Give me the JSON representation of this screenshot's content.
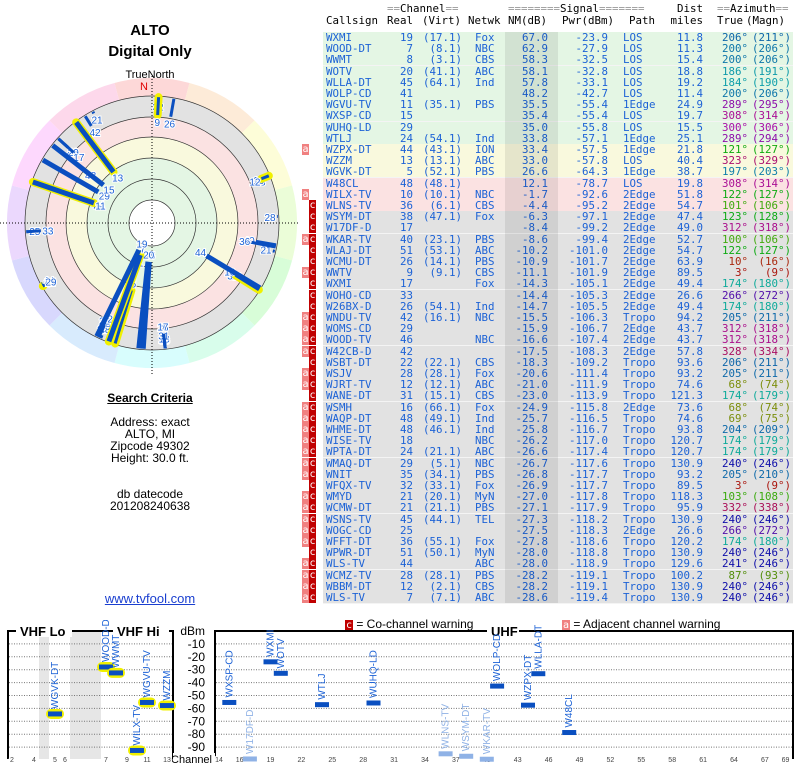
{
  "left": {
    "location": "ALTO",
    "mode": "Digital Only",
    "north_label": "TrueNorth",
    "north_marker": "N",
    "criteria_title": "Search Criteria",
    "criteria": [
      "Address: exact",
      "ALTO, MI",
      "Zipcode 49302",
      "Height: 30.0 ft."
    ],
    "datecode_label": "db datecode",
    "datecode": "201208240638",
    "link": "www.tvfool.com"
  },
  "table": {
    "group_headers": {
      "channel": "Channel",
      "signal": "Signal",
      "dist": "Dist",
      "azimuth": "Azimuth"
    },
    "columns": [
      "Callsign",
      "Real",
      "(Virt)",
      "Netwk",
      "NM(dB)",
      "Pwr(dBm)",
      "Path",
      "miles",
      "True",
      "(Magn)"
    ],
    "zone_colors": {
      "green": "#e4f6e4",
      "yellow": "#f9f9dd",
      "red": "#fbe2e2",
      "gray": "#e2e2e2"
    },
    "rows": [
      {
        "z": "green",
        "f": "",
        "cs": "WXMI",
        "real": 19,
        "virt": "(17.1)",
        "net": "Fox",
        "nm": "67.0",
        "pwr": "-23.9",
        "path": "LOS",
        "dist": "11.8",
        "az": 206,
        "mag": 211
      },
      {
        "z": "green",
        "f": "",
        "cs": "WOOD-DT",
        "real": 7,
        "virt": "(8.1)",
        "net": "NBC",
        "nm": "62.9",
        "pwr": "-27.9",
        "path": "LOS",
        "dist": "11.3",
        "az": 200,
        "mag": 206
      },
      {
        "z": "green",
        "f": "",
        "cs": "WWMT",
        "real": 8,
        "virt": "(3.1)",
        "net": "CBS",
        "nm": "58.3",
        "pwr": "-32.5",
        "path": "LOS",
        "dist": "15.4",
        "az": 200,
        "mag": 206
      },
      {
        "z": "green",
        "f": "",
        "cs": "WOTV",
        "real": 20,
        "virt": "(41.1)",
        "net": "ABC",
        "nm": "58.1",
        "pwr": "-32.8",
        "path": "LOS",
        "dist": "18.8",
        "az": 186,
        "mag": 191
      },
      {
        "z": "green",
        "f": "",
        "cs": "WLLA-DT",
        "real": 45,
        "virt": "(64.1)",
        "net": "Ind",
        "nm": "57.8",
        "pwr": "-33.1",
        "path": "LOS",
        "dist": "19.2",
        "az": 184,
        "mag": 190
      },
      {
        "z": "green",
        "f": "",
        "cs": "WOLP-CD",
        "real": 41,
        "virt": "",
        "net": "",
        "nm": "48.2",
        "pwr": "-42.7",
        "path": "LOS",
        "dist": "11.4",
        "az": 200,
        "mag": 206
      },
      {
        "z": "green",
        "f": "",
        "cs": "WGVU-TV",
        "real": 11,
        "virt": "(35.1)",
        "net": "PBS",
        "nm": "35.5",
        "pwr": "-55.4",
        "path": "1Edge",
        "dist": "24.9",
        "az": 289,
        "mag": 295
      },
      {
        "z": "green",
        "f": "",
        "cs": "WXSP-CD",
        "real": 15,
        "virt": "",
        "net": "",
        "nm": "35.4",
        "pwr": "-55.4",
        "path": "LOS",
        "dist": "19.7",
        "az": 308,
        "mag": 314
      },
      {
        "z": "green",
        "f": "",
        "cs": "WUHQ-LD",
        "real": 29,
        "virt": "",
        "net": "",
        "nm": "35.0",
        "pwr": "-55.8",
        "path": "LOS",
        "dist": "15.5",
        "az": 300,
        "mag": 306
      },
      {
        "z": "green",
        "f": "",
        "cs": "WTLJ",
        "real": 24,
        "virt": "(54.1)",
        "net": "Ind",
        "nm": "33.8",
        "pwr": "-57.1",
        "path": "1Edge",
        "dist": "25.1",
        "az": 289,
        "mag": 294
      },
      {
        "z": "yellow",
        "f": "a",
        "cs": "WZPX-DT",
        "real": 44,
        "virt": "(43.1)",
        "net": "ION",
        "nm": "33.4",
        "pwr": "-57.5",
        "path": "1Edge",
        "dist": "21.8",
        "az": 121,
        "mag": 127
      },
      {
        "z": "yellow",
        "f": "",
        "cs": "WZZM",
        "real": 13,
        "virt": "(13.1)",
        "net": "ABC",
        "nm": "33.0",
        "pwr": "-57.8",
        "path": "LOS",
        "dist": "40.4",
        "az": 323,
        "mag": 329
      },
      {
        "z": "yellow",
        "f": "",
        "cs": "WGVK-DT",
        "real": 5,
        "virt": "(52.1)",
        "net": "PBS",
        "nm": "26.6",
        "pwr": "-64.3",
        "path": "1Edge",
        "dist": "38.7",
        "az": 197,
        "mag": 203
      },
      {
        "z": "red",
        "f": "",
        "cs": "W48CL",
        "real": 48,
        "virt": "(48.1)",
        "net": "",
        "nm": "12.1",
        "pwr": "-78.7",
        "path": "LOS",
        "dist": "19.8",
        "az": 308,
        "mag": 314
      },
      {
        "z": "red",
        "f": "a",
        "cs": "WILX-TV",
        "real": 10,
        "virt": "(10.1)",
        "net": "NBC",
        "nm": "-1.7",
        "pwr": "-92.6",
        "path": "2Edge",
        "dist": "51.8",
        "az": 122,
        "mag": 127
      },
      {
        "z": "red",
        "f": "c",
        "cs": "WLNS-TV",
        "real": 36,
        "virt": "(6.1)",
        "net": "CBS",
        "nm": "-4.4",
        "pwr": "-95.2",
        "path": "2Edge",
        "dist": "54.7",
        "az": 101,
        "mag": 106
      },
      {
        "z": "gray",
        "f": "c",
        "cs": "WSYM-DT",
        "real": 38,
        "virt": "(47.1)",
        "net": "Fox",
        "nm": "-6.3",
        "pwr": "-97.1",
        "path": "2Edge",
        "dist": "47.4",
        "az": 123,
        "mag": 128
      },
      {
        "z": "gray",
        "f": "c",
        "cs": "W17DF-D",
        "real": 17,
        "virt": "",
        "net": "",
        "nm": "-8.4",
        "pwr": "-99.2",
        "path": "2Edge",
        "dist": "49.0",
        "az": 312,
        "mag": 318
      },
      {
        "z": "gray",
        "f": "ac",
        "cs": "WKAR-TV",
        "real": 40,
        "virt": "(23.1)",
        "net": "PBS",
        "nm": "-8.6",
        "pwr": "-99.4",
        "path": "2Edge",
        "dist": "52.7",
        "az": 100,
        "mag": 106
      },
      {
        "z": "gray",
        "f": "c",
        "cs": "WLAJ-DT",
        "real": 51,
        "virt": "(53.1)",
        "net": "ABC",
        "nm": "-10.2",
        "pwr": "-101.0",
        "path": "2Edge",
        "dist": "54.7",
        "az": 122,
        "mag": 127
      },
      {
        "z": "gray",
        "f": "c",
        "cs": "WCMU-DT",
        "real": 26,
        "virt": "(14.1)",
        "net": "PBS",
        "nm": "-10.9",
        "pwr": "-101.7",
        "path": "2Edge",
        "dist": "63.9",
        "az": 10,
        "mag": 16
      },
      {
        "z": "gray",
        "f": "ac",
        "cs": "WWTV",
        "real": 9,
        "virt": "(9.1)",
        "net": "CBS",
        "nm": "-11.1",
        "pwr": "-101.9",
        "path": "2Edge",
        "dist": "89.5",
        "az": 3,
        "mag": 9
      },
      {
        "z": "gray",
        "f": "c",
        "cs": "WXMI",
        "real": 17,
        "virt": "",
        "net": "Fox",
        "nm": "-14.3",
        "pwr": "-105.1",
        "path": "2Edge",
        "dist": "49.4",
        "az": 174,
        "mag": 180
      },
      {
        "z": "gray",
        "f": "c",
        "cs": "WOHO-CD",
        "real": 33,
        "virt": "",
        "net": "",
        "nm": "-14.4",
        "pwr": "-105.3",
        "path": "2Edge",
        "dist": "26.6",
        "az": 266,
        "mag": 272
      },
      {
        "z": "gray",
        "f": "c",
        "cs": "W26BX-D",
        "real": 26,
        "virt": "(54.1)",
        "net": "Ind",
        "nm": "-14.7",
        "pwr": "-105.5",
        "path": "2Edge",
        "dist": "49.4",
        "az": 174,
        "mag": 180
      },
      {
        "z": "gray",
        "f": "ac",
        "cs": "WNDU-TV",
        "real": 42,
        "virt": "(16.1)",
        "net": "NBC",
        "nm": "-15.5",
        "pwr": "-106.3",
        "path": "Tropo",
        "dist": "94.2",
        "az": 205,
        "mag": 211
      },
      {
        "z": "gray",
        "f": "ac",
        "cs": "WOMS-CD",
        "real": 29,
        "virt": "",
        "net": "",
        "nm": "-15.9",
        "pwr": "-106.7",
        "path": "2Edge",
        "dist": "43.7",
        "az": 312,
        "mag": 318
      },
      {
        "z": "gray",
        "f": "ac",
        "cs": "WOOD-TV",
        "real": 46,
        "virt": "",
        "net": "NBC",
        "nm": "-16.6",
        "pwr": "-107.4",
        "path": "2Edge",
        "dist": "43.7",
        "az": 312,
        "mag": 318
      },
      {
        "z": "gray",
        "f": "ac",
        "cs": "W42CB-D",
        "real": 42,
        "virt": "",
        "net": "",
        "nm": "-17.5",
        "pwr": "-108.3",
        "path": "2Edge",
        "dist": "57.8",
        "az": 328,
        "mag": 334
      },
      {
        "z": "gray",
        "f": "c",
        "cs": "WSBT-DT",
        "real": 22,
        "virt": "(22.1)",
        "net": "CBS",
        "nm": "-18.3",
        "pwr": "-109.2",
        "path": "Tropo",
        "dist": "93.6",
        "az": 206,
        "mag": 211
      },
      {
        "z": "gray",
        "f": "ac",
        "cs": "WSJV",
        "real": 28,
        "virt": "(28.1)",
        "net": "Fox",
        "nm": "-20.6",
        "pwr": "-111.4",
        "path": "Tropo",
        "dist": "93.2",
        "az": 205,
        "mag": 211
      },
      {
        "z": "gray",
        "f": "ac",
        "cs": "WJRT-TV",
        "real": 12,
        "virt": "(12.1)",
        "net": "ABC",
        "nm": "-21.0",
        "pwr": "-111.9",
        "path": "Tropo",
        "dist": "74.6",
        "az": 68,
        "mag": 74
      },
      {
        "z": "gray",
        "f": "c",
        "cs": "WANE-DT",
        "real": 31,
        "virt": "(15.1)",
        "net": "CBS",
        "nm": "-23.0",
        "pwr": "-113.9",
        "path": "Tropo",
        "dist": "121.3",
        "az": 174,
        "mag": 179
      },
      {
        "z": "gray",
        "f": "ac",
        "cs": "WSMH",
        "real": 16,
        "virt": "(66.1)",
        "net": "Fox",
        "nm": "-24.9",
        "pwr": "-115.8",
        "path": "2Edge",
        "dist": "73.6",
        "az": 68,
        "mag": 74
      },
      {
        "z": "gray",
        "f": "ac",
        "cs": "WAQP-DT",
        "real": 48,
        "virt": "(49.1)",
        "net": "Ind",
        "nm": "-25.7",
        "pwr": "-116.5",
        "path": "Tropo",
        "dist": "74.6",
        "az": 69,
        "mag": 75
      },
      {
        "z": "gray",
        "f": "ac",
        "cs": "WHME-DT",
        "real": 48,
        "virt": "(46.1)",
        "net": "Ind",
        "nm": "-25.8",
        "pwr": "-116.7",
        "path": "Tropo",
        "dist": "93.8",
        "az": 204,
        "mag": 209
      },
      {
        "z": "gray",
        "f": "ac",
        "cs": "WISE-TV",
        "real": 18,
        "virt": "",
        "net": "NBC",
        "nm": "-26.2",
        "pwr": "-117.0",
        "path": "Tropo",
        "dist": "120.7",
        "az": 174,
        "mag": 179
      },
      {
        "z": "gray",
        "f": "ac",
        "cs": "WPTA-DT",
        "real": 24,
        "virt": "(21.1)",
        "net": "ABC",
        "nm": "-26.6",
        "pwr": "-117.4",
        "path": "Tropo",
        "dist": "120.7",
        "az": 174,
        "mag": 179
      },
      {
        "z": "gray",
        "f": "ac",
        "cs": "WMAQ-DT",
        "real": 29,
        "virt": "(5.1)",
        "net": "NBC",
        "nm": "-26.7",
        "pwr": "-117.6",
        "path": "Tropo",
        "dist": "130.9",
        "az": 240,
        "mag": 246
      },
      {
        "z": "gray",
        "f": "ac",
        "cs": "WNIT",
        "real": 35,
        "virt": "(34.1)",
        "net": "PBS",
        "nm": "-26.8",
        "pwr": "-117.7",
        "path": "Tropo",
        "dist": "93.2",
        "az": 205,
        "mag": 210
      },
      {
        "z": "gray",
        "f": "c",
        "cs": "WFQX-TV",
        "real": 32,
        "virt": "(33.1)",
        "net": "Fox",
        "nm": "-26.9",
        "pwr": "-117.7",
        "path": "Tropo",
        "dist": "89.5",
        "az": 3,
        "mag": 9
      },
      {
        "z": "gray",
        "f": "ac",
        "cs": "WMYD",
        "real": 21,
        "virt": "(20.1)",
        "net": "MyN",
        "nm": "-27.0",
        "pwr": "-117.8",
        "path": "Tropo",
        "dist": "118.3",
        "az": 103,
        "mag": 108
      },
      {
        "z": "gray",
        "f": "ac",
        "cs": "WCMW-DT",
        "real": 21,
        "virt": "(21.1)",
        "net": "PBS",
        "nm": "-27.1",
        "pwr": "-117.9",
        "path": "Tropo",
        "dist": "95.9",
        "az": 332,
        "mag": 338
      },
      {
        "z": "gray",
        "f": "ac",
        "cs": "WSNS-TV",
        "real": 45,
        "virt": "(44.1)",
        "net": "TEL",
        "nm": "-27.3",
        "pwr": "-118.2",
        "path": "Tropo",
        "dist": "130.9",
        "az": 240,
        "mag": 246
      },
      {
        "z": "gray",
        "f": "ac",
        "cs": "WOGC-CD",
        "real": 25,
        "virt": "",
        "net": "",
        "nm": "-27.5",
        "pwr": "-118.3",
        "path": "2Edge",
        "dist": "26.6",
        "az": 266,
        "mag": 272
      },
      {
        "z": "gray",
        "f": "ac",
        "cs": "WFFT-DT",
        "real": 36,
        "virt": "(55.1)",
        "net": "Fox",
        "nm": "-27.8",
        "pwr": "-118.6",
        "path": "Tropo",
        "dist": "120.2",
        "az": 174,
        "mag": 180
      },
      {
        "z": "gray",
        "f": "c",
        "cs": "WPWR-DT",
        "real": 51,
        "virt": "(50.1)",
        "net": "MyN",
        "nm": "-28.0",
        "pwr": "-118.8",
        "path": "Tropo",
        "dist": "130.9",
        "az": 240,
        "mag": 246
      },
      {
        "z": "gray",
        "f": "ac",
        "cs": "WLS-TV",
        "real": 44,
        "virt": "",
        "net": "ABC",
        "nm": "-28.0",
        "pwr": "-118.9",
        "path": "Tropo",
        "dist": "129.6",
        "az": 241,
        "mag": 246
      },
      {
        "z": "gray",
        "f": "ac",
        "cs": "WCMZ-TV",
        "real": 28,
        "virt": "(28.1)",
        "net": "PBS",
        "nm": "-28.2",
        "pwr": "-119.1",
        "path": "Tropo",
        "dist": "100.2",
        "az": 87,
        "mag": 93
      },
      {
        "z": "gray",
        "f": "ac",
        "cs": "WBBM-DT",
        "real": 12,
        "virt": "(2.1)",
        "net": "CBS",
        "nm": "-28.2",
        "pwr": "-119.1",
        "path": "Tropo",
        "dist": "130.9",
        "az": 240,
        "mag": 246
      },
      {
        "z": "gray",
        "f": "ac",
        "cs": "WLS-TV",
        "real": 7,
        "virt": "(7.1)",
        "net": "ABC",
        "nm": "-28.6",
        "pwr": "-119.4",
        "path": "Tropo",
        "dist": "130.9",
        "az": 240,
        "mag": 246
      }
    ]
  },
  "legend": {
    "co_flag": "c",
    "co_text": "= Co-channel warning",
    "adj_flag": "a",
    "adj_text": "= Adjacent channel warning",
    "co_color": "#c00000",
    "adj_color": "#f08080"
  },
  "spectrum": {
    "vhf_lo": "VHF Lo",
    "vhf_hi": "VHF Hi",
    "uhf": "UHF",
    "unit": "dBm",
    "channel_label": "Channel",
    "dbm_ticks": [
      -10,
      -20,
      -30,
      -40,
      -50,
      -60,
      -70,
      -80,
      -90
    ],
    "vhf_ticks": [
      2,
      4,
      5,
      6,
      7,
      9,
      11,
      13
    ],
    "uhf_ticks": [
      14,
      16,
      19,
      22,
      25,
      28,
      31,
      34,
      37,
      40,
      43,
      46,
      49,
      52,
      55,
      58,
      61,
      64,
      67,
      69
    ],
    "marker_color": "#0a4fc0",
    "vhf_outline": "#f0f000"
  }
}
